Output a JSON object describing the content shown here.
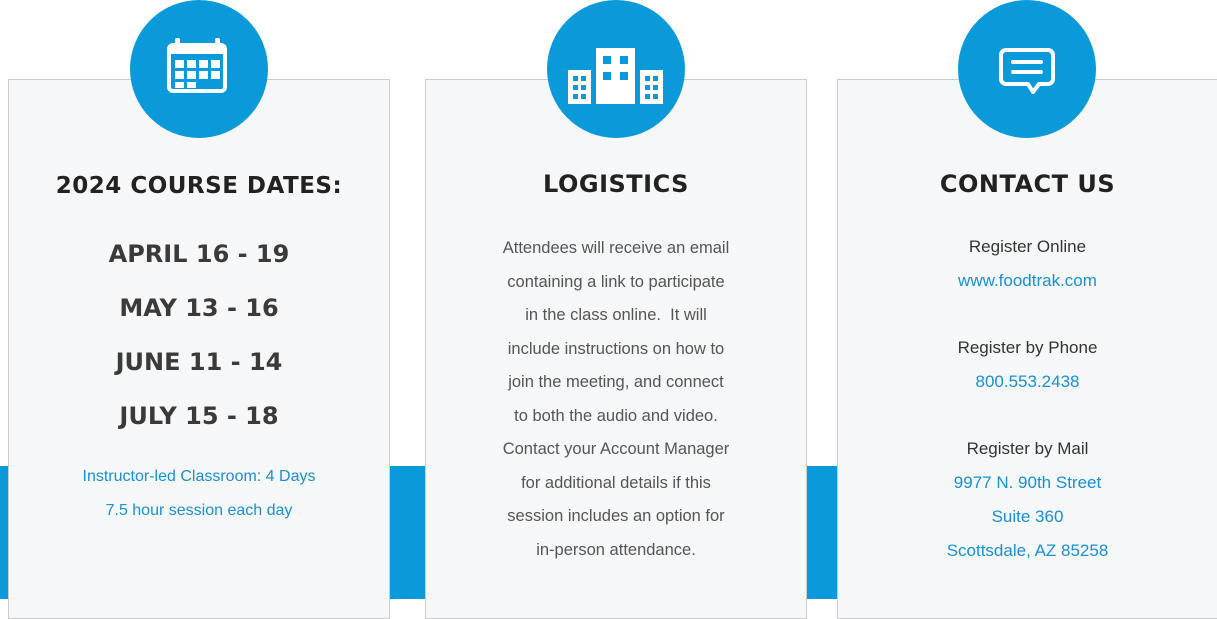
{
  "colors": {
    "accent": "#0b9ad9",
    "link": "#1a8fd1",
    "card_bg": "#f6f7f8"
  },
  "cards": [
    {
      "icon": "calendar-icon",
      "title": "2024 COURSE DATES:",
      "dates": [
        "APRIL 16 - 19",
        "MAY 13 - 16",
        "JUNE 11 - 14",
        "JULY 15 - 18"
      ],
      "note": [
        "Instructor-led Classroom: 4 Days",
        "7.5 hour session each day"
      ]
    },
    {
      "icon": "buildings-icon",
      "title": "LOGISTICS",
      "lines": [
        "Attendees will receive an email",
        "containing a link to participate",
        "in the class online.  It will",
        "include instructions on how to",
        "join the meeting, and connect",
        "to both the audio and video.",
        "Contact your Account Manager",
        "for additional details if this",
        "session includes an option for",
        "in-person attendance."
      ]
    },
    {
      "icon": "chat-icon",
      "title": "CONTACT US",
      "online_label": "Register Online",
      "online_value": "www.foodtrak.com",
      "phone_label": "Register by Phone",
      "phone_value": "800.553.2438",
      "mail_label": "Register by Mail",
      "mail_lines": [
        "9977 N. 90th Street",
        "Suite 360",
        "Scottsdale, AZ 85258"
      ]
    }
  ]
}
